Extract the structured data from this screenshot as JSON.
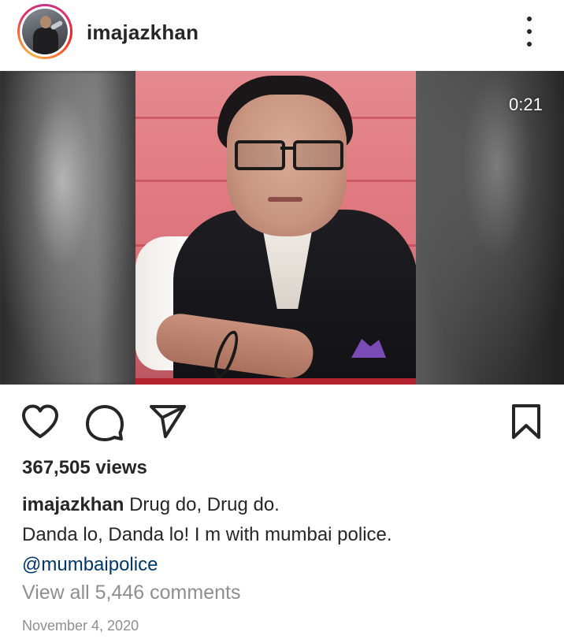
{
  "post": {
    "username": "imajazkhan",
    "video": {
      "duration": "0:21"
    },
    "views": "367,505 views",
    "caption": {
      "username": "imajazkhan",
      "line1": "Drug do, Drug do.",
      "line2": "Danda lo, Danda lo! I m with mumbai police.",
      "mention": "@mumbaipolice"
    },
    "comments_link": "View all 5,446 comments",
    "date": "November 4, 2020"
  },
  "icons": {
    "more": "more-vertical-icon",
    "like": "heart-icon",
    "comment": "comment-bubble-icon",
    "share": "paper-plane-icon",
    "save": "bookmark-icon"
  },
  "colors": {
    "text": "#262626",
    "muted": "#8e8e8e",
    "mention": "#00376b",
    "story_ring": [
      "#c13584",
      "#e1306c",
      "#fd1d1d",
      "#f77737",
      "#fcaf45"
    ]
  }
}
